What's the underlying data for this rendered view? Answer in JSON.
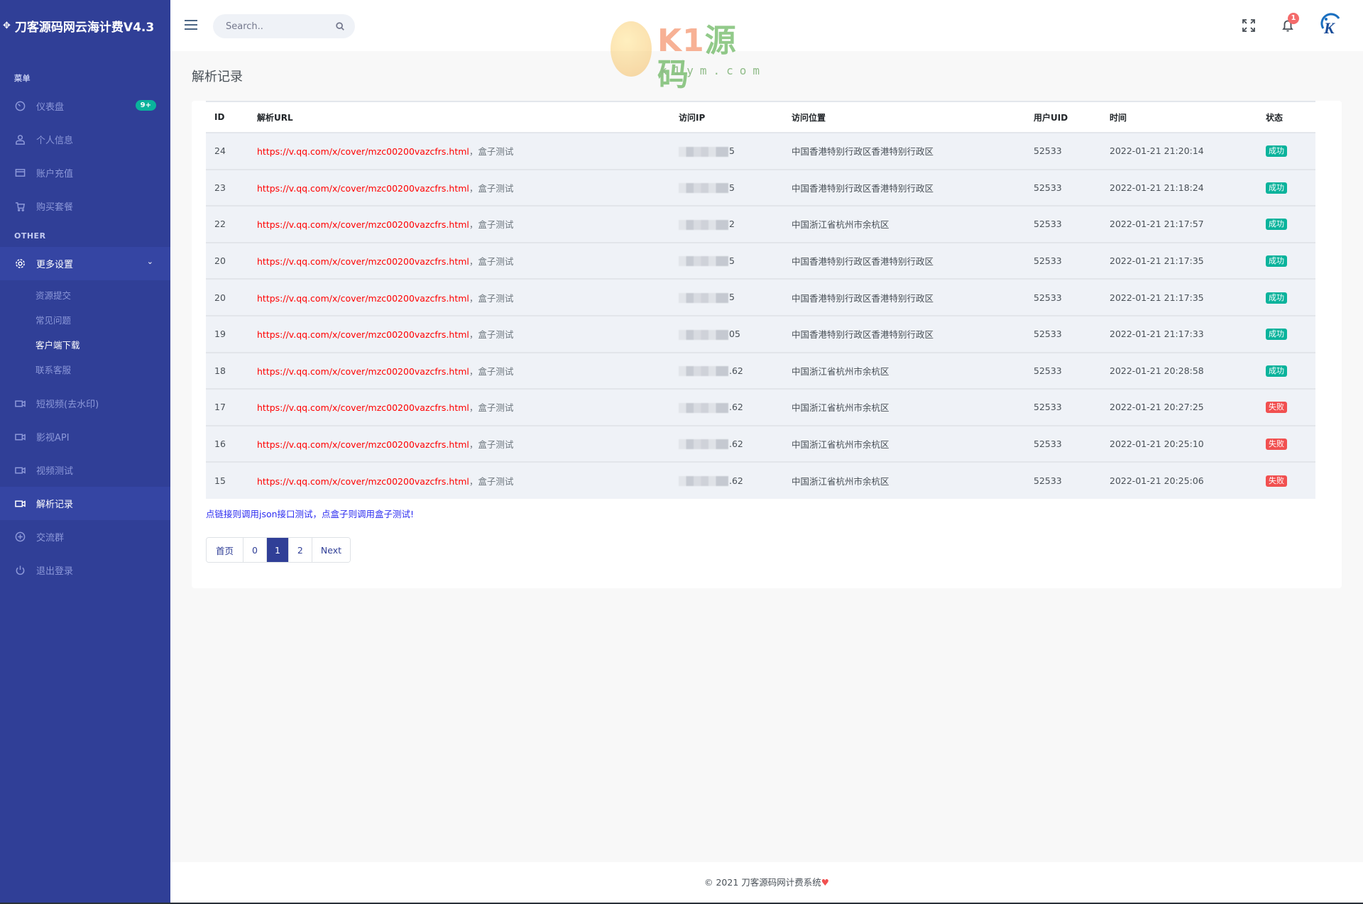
{
  "brand": {
    "icon": "move-icon",
    "title": "刀客源码网云海计费V4.3"
  },
  "sidebar": {
    "section_menu": "菜单",
    "items": [
      {
        "label": "仪表盘",
        "icon": "dashboard-icon",
        "badge": "9+"
      },
      {
        "label": "个人信息",
        "icon": "user-icon"
      },
      {
        "label": "账户充值",
        "icon": "card-icon"
      },
      {
        "label": "购买套餐",
        "icon": "cart-icon"
      }
    ],
    "section_other": "OTHER",
    "more_settings": {
      "label": "更多设置",
      "icon": "gear-icon",
      "subitems": [
        "资源提交",
        "常见问题",
        "客户端下载",
        "联系客服"
      ]
    },
    "other_items": [
      {
        "label": "短视频(去水印)",
        "icon": "video-icon"
      },
      {
        "label": "影视API",
        "icon": "video-icon"
      },
      {
        "label": "视频测试",
        "icon": "video-icon"
      },
      {
        "label": "解析记录",
        "icon": "video-icon"
      },
      {
        "label": "交流群",
        "icon": "plus-circle-icon"
      },
      {
        "label": "退出登录",
        "icon": "power-icon"
      }
    ]
  },
  "header": {
    "search_placeholder": "Search..",
    "notification_count": "1",
    "watermark": {
      "brand": "K1",
      "brand_cn": "源码",
      "site": "k1ym.com"
    }
  },
  "page": {
    "title": "解析记录",
    "table": {
      "columns": [
        "ID",
        "解析URL",
        "访问IP",
        "访问位置",
        "用户UID",
        "时间",
        "状态"
      ],
      "rows": [
        {
          "id": "24",
          "url": "https://v.qq.com/x/cover/mzc00200vazcfrs.html",
          "box": "盒子测试",
          "ip_suffix": "5",
          "location": "中国香港特别行政区香港特别行政区",
          "uid": "52533",
          "time": "2022-01-21 21:20:14",
          "status": "成功",
          "ok": true
        },
        {
          "id": "23",
          "url": "https://v.qq.com/x/cover/mzc00200vazcfrs.html",
          "box": "盒子测试",
          "ip_suffix": "5",
          "location": "中国香港特别行政区香港特别行政区",
          "uid": "52533",
          "time": "2022-01-21 21:18:24",
          "status": "成功",
          "ok": true
        },
        {
          "id": "22",
          "url": "https://v.qq.com/x/cover/mzc00200vazcfrs.html",
          "box": "盒子测试",
          "ip_suffix": "2",
          "location": "中国浙江省杭州市余杭区",
          "uid": "52533",
          "time": "2022-01-21 21:17:57",
          "status": "成功",
          "ok": true
        },
        {
          "id": "20",
          "url": "https://v.qq.com/x/cover/mzc00200vazcfrs.html",
          "box": "盒子测试",
          "ip_suffix": "5",
          "location": "中国香港特别行政区香港特别行政区",
          "uid": "52533",
          "time": "2022-01-21 21:17:35",
          "status": "成功",
          "ok": true
        },
        {
          "id": "20",
          "url": "https://v.qq.com/x/cover/mzc00200vazcfrs.html",
          "box": "盒子测试",
          "ip_suffix": "5",
          "location": "中国香港特别行政区香港特别行政区",
          "uid": "52533",
          "time": "2022-01-21 21:17:35",
          "status": "成功",
          "ok": true
        },
        {
          "id": "19",
          "url": "https://v.qq.com/x/cover/mzc00200vazcfrs.html",
          "box": "盒子测试",
          "ip_suffix": "05",
          "location": "中国香港特别行政区香港特别行政区",
          "uid": "52533",
          "time": "2022-01-21 21:17:33",
          "status": "成功",
          "ok": true
        },
        {
          "id": "18",
          "url": "https://v.qq.com/x/cover/mzc00200vazcfrs.html",
          "box": "盒子测试",
          "ip_suffix": ".62",
          "location": "中国浙江省杭州市余杭区",
          "uid": "52533",
          "time": "2022-01-21 20:28:58",
          "status": "成功",
          "ok": true
        },
        {
          "id": "17",
          "url": "https://v.qq.com/x/cover/mzc00200vazcfrs.html",
          "box": "盒子测试",
          "ip_suffix": ".62",
          "location": "中国浙江省杭州市余杭区",
          "uid": "52533",
          "time": "2022-01-21 20:27:25",
          "status": "失败",
          "ok": false
        },
        {
          "id": "16",
          "url": "https://v.qq.com/x/cover/mzc00200vazcfrs.html",
          "box": "盒子测试",
          "ip_suffix": ".62",
          "location": "中国浙江省杭州市余杭区",
          "uid": "52533",
          "time": "2022-01-21 20:25:10",
          "status": "失败",
          "ok": false
        },
        {
          "id": "15",
          "url": "https://v.qq.com/x/cover/mzc00200vazcfrs.html",
          "box": "盒子测试",
          "ip_suffix": ".62",
          "location": "中国浙江省杭州市余杭区",
          "uid": "52533",
          "time": "2022-01-21 20:25:06",
          "status": "失败",
          "ok": false
        }
      ]
    },
    "url_separator": "，",
    "note": "点链接则调用json接口测试，点盒子则调用盒子测试!",
    "pagination": [
      "首页",
      "0",
      "1",
      "2",
      "Next"
    ],
    "current_page": "1"
  },
  "colors": {
    "sidebar": "#303f97",
    "success": "#0ab39c",
    "danger": "#f15050",
    "link": "#ff0000"
  },
  "footer": {
    "text": "© 2021 刀客源码网计费系统",
    "heart": "♥"
  }
}
